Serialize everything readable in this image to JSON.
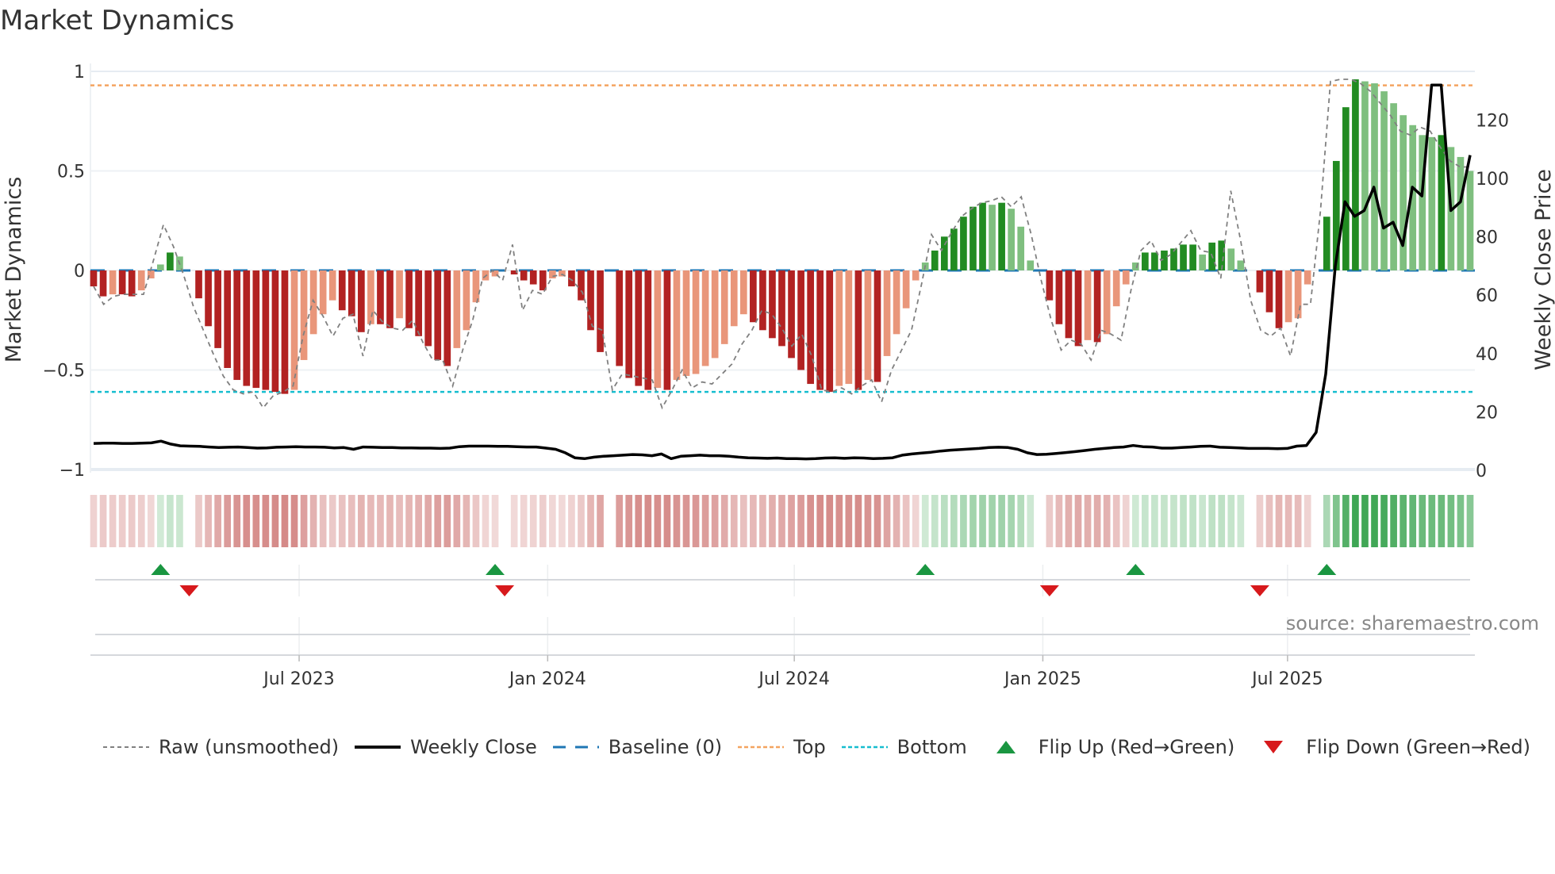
{
  "title": "Market Dynamics",
  "source": "source: sharemaestro.com",
  "legend": [
    {
      "key": "raw",
      "label": "Raw (unsmoothed)"
    },
    {
      "key": "close",
      "label": "Weekly Close"
    },
    {
      "key": "baseline",
      "label": "Baseline (0)"
    },
    {
      "key": "top",
      "label": "Top"
    },
    {
      "key": "bottom",
      "label": "Bottom"
    },
    {
      "key": "flip_up",
      "label": "Flip Up (Red→Green)"
    },
    {
      "key": "flip_down",
      "label": "Flip Down (Green→Red)"
    }
  ],
  "colors": {
    "dark_green": "#228b22",
    "light_green": "#7fbf7f",
    "dark_red": "#b22222",
    "light_red": "#e9967a",
    "baseline": "#1f77b4",
    "top": "#f4a460",
    "bottom": "#17becf",
    "raw": "#808080",
    "close": "#000000",
    "flip_up": "#1a9641",
    "flip_down": "#d7191c"
  },
  "chart_data": {
    "type": "bar",
    "title": "Market Dynamics",
    "ylabel": "Market Dynamics",
    "y2label": "Weekly Close Price",
    "ylim": [
      -1,
      1
    ],
    "y2lim": [
      0,
      136
    ],
    "yticks": [
      {
        "v": 1,
        "label": "1"
      },
      {
        "v": 0.5,
        "label": "0.5"
      },
      {
        "v": 0,
        "label": "0"
      },
      {
        "v": -0.5,
        "label": "−0.5"
      },
      {
        "v": -1,
        "label": "−1"
      }
    ],
    "y2ticks": [
      {
        "v": 0,
        "label": "0"
      },
      {
        "v": 20,
        "label": "20"
      },
      {
        "v": 40,
        "label": "40"
      },
      {
        "v": 60,
        "label": "60"
      },
      {
        "v": 80,
        "label": "80"
      },
      {
        "v": 100,
        "label": "100"
      },
      {
        "v": 120,
        "label": "120"
      }
    ],
    "xticks": [
      {
        "week": 21.5,
        "label": "Jul 2023"
      },
      {
        "week": 47.5,
        "label": "Jan 2024"
      },
      {
        "week": 73.3,
        "label": "Jul 2024"
      },
      {
        "week": 99.3,
        "label": "Jan 2025"
      },
      {
        "week": 124.9,
        "label": "Jul 2025"
      }
    ],
    "top": 0.93,
    "bottom": -0.61,
    "dynamics": [
      -0.08,
      -0.13,
      -0.12,
      -0.12,
      -0.13,
      -0.1,
      -0.04,
      0.03,
      0.09,
      0.07,
      0.0,
      -0.14,
      -0.28,
      -0.39,
      -0.49,
      -0.55,
      -0.58,
      -0.59,
      -0.6,
      -0.61,
      -0.62,
      -0.6,
      -0.45,
      -0.32,
      -0.22,
      -0.15,
      -0.2,
      -0.23,
      -0.31,
      -0.27,
      -0.27,
      -0.29,
      -0.24,
      -0.29,
      -0.33,
      -0.38,
      -0.45,
      -0.48,
      -0.39,
      -0.3,
      -0.16,
      -0.05,
      -0.03,
      0.0,
      -0.02,
      -0.05,
      -0.07,
      -0.1,
      -0.04,
      -0.03,
      -0.08,
      -0.15,
      -0.3,
      -0.41,
      0.0,
      -0.48,
      -0.54,
      -0.58,
      -0.6,
      -0.59,
      -0.6,
      -0.55,
      -0.53,
      -0.52,
      -0.48,
      -0.44,
      -0.37,
      -0.28,
      -0.22,
      -0.26,
      -0.3,
      -0.34,
      -0.38,
      -0.44,
      -0.5,
      -0.57,
      -0.6,
      -0.61,
      -0.58,
      -0.57,
      -0.6,
      -0.55,
      -0.56,
      -0.43,
      -0.32,
      -0.19,
      -0.05,
      0.04,
      0.1,
      0.17,
      0.21,
      0.27,
      0.32,
      0.34,
      0.33,
      0.34,
      0.31,
      0.22,
      0.05,
      0.0,
      -0.15,
      -0.27,
      -0.34,
      -0.38,
      -0.35,
      -0.36,
      -0.32,
      -0.18,
      -0.07,
      0.04,
      0.09,
      0.09,
      0.1,
      0.11,
      0.13,
      0.13,
      0.08,
      0.14,
      0.15,
      0.11,
      0.05,
      0.0,
      -0.11,
      -0.21,
      -0.29,
      -0.26,
      -0.24,
      -0.07,
      0.0,
      0.27,
      0.55,
      0.82,
      0.96,
      0.95,
      0.94,
      0.9,
      0.84,
      0.78,
      0.73,
      0.68,
      0.67,
      0.68,
      0.62,
      0.57,
      0.5
    ],
    "raw": [
      -0.08,
      -0.17,
      -0.13,
      -0.12,
      -0.12,
      -0.12,
      0.05,
      0.23,
      0.12,
      -0.02,
      -0.18,
      -0.3,
      -0.42,
      -0.53,
      -0.6,
      -0.62,
      -0.61,
      -0.69,
      -0.63,
      -0.61,
      -0.58,
      -0.33,
      -0.15,
      -0.23,
      -0.33,
      -0.24,
      -0.22,
      -0.43,
      -0.2,
      -0.26,
      -0.29,
      -0.3,
      -0.25,
      -0.36,
      -0.45,
      -0.45,
      -0.58,
      -0.4,
      -0.25,
      -0.04,
      0.0,
      -0.05,
      0.13,
      -0.2,
      -0.1,
      -0.12,
      -0.03,
      -0.02,
      -0.05,
      -0.11,
      -0.28,
      -0.3,
      -0.6,
      -0.52,
      -0.53,
      -0.54,
      -0.55,
      -0.69,
      -0.6,
      -0.5,
      -0.59,
      -0.56,
      -0.57,
      -0.52,
      -0.47,
      -0.37,
      -0.3,
      -0.2,
      -0.22,
      -0.29,
      -0.38,
      -0.32,
      -0.43,
      -0.6,
      -0.61,
      -0.59,
      -0.62,
      -0.58,
      -0.55,
      -0.66,
      -0.5,
      -0.4,
      -0.3,
      -0.07,
      0.18,
      0.1,
      0.19,
      0.27,
      0.31,
      0.34,
      0.35,
      0.37,
      0.32,
      0.37,
      0.18,
      -0.05,
      -0.25,
      -0.4,
      -0.35,
      -0.37,
      -0.45,
      -0.3,
      -0.32,
      -0.35,
      -0.1,
      0.1,
      0.15,
      0.05,
      0.08,
      0.14,
      0.2,
      0.1,
      0.09,
      -0.04,
      0.4,
      0.15,
      -0.15,
      -0.3,
      -0.33,
      -0.29,
      -0.43,
      -0.17,
      -0.17,
      0.3,
      0.95,
      0.96,
      0.96,
      0.94,
      0.9,
      0.84,
      0.78,
      0.7,
      0.68,
      0.72,
      0.7,
      0.62,
      0.55,
      0.52,
      0.52
    ],
    "weekly_close": [
      9.2,
      9.3,
      9.3,
      9.2,
      9.2,
      9.3,
      9.4,
      10.0,
      9.0,
      8.4,
      8.3,
      8.2,
      8.0,
      7.8,
      7.9,
      8.0,
      7.8,
      7.6,
      7.7,
      7.9,
      8.0,
      8.1,
      8.0,
      8.0,
      7.9,
      7.7,
      7.8,
      7.2,
      8.0,
      7.9,
      7.8,
      7.8,
      7.7,
      7.7,
      7.6,
      7.6,
      7.5,
      7.6,
      8.1,
      8.3,
      8.3,
      8.3,
      8.2,
      8.2,
      8.1,
      8.0,
      8.0,
      7.6,
      7.2,
      6.0,
      4.3,
      4.0,
      4.5,
      4.8,
      5.0,
      5.2,
      5.4,
      5.3,
      5.0,
      5.6,
      4.0,
      4.8,
      5.0,
      5.2,
      5.0,
      5.0,
      4.8,
      4.5,
      4.3,
      4.2,
      4.1,
      4.2,
      4.0,
      4.0,
      3.9,
      4.0,
      4.2,
      4.3,
      4.1,
      4.3,
      4.2,
      4.0,
      4.1,
      4.3,
      5.2,
      5.6,
      5.9,
      6.2,
      6.6,
      6.9,
      7.1,
      7.3,
      7.5,
      7.8,
      7.9,
      7.8,
      7.2,
      6.0,
      5.4,
      5.5,
      5.8,
      6.1,
      6.4,
      6.8,
      7.2,
      7.5,
      7.8,
      8.0,
      8.5,
      8.1,
      8.0,
      7.6,
      7.6,
      7.8,
      8.0,
      8.2,
      8.3,
      7.9,
      7.8,
      7.7,
      7.5,
      7.5,
      7.5,
      7.4,
      7.5,
      8.3,
      8.5,
      13,
      33,
      70,
      92,
      87,
      89,
      97,
      83,
      85,
      77,
      97,
      94,
      132,
      132,
      89,
      92,
      108
    ],
    "flip_up_weeks": [
      7,
      42,
      87,
      109,
      129
    ],
    "flip_down_weeks": [
      10,
      43,
      100,
      122
    ],
    "grid": true,
    "legend_position": "bottom"
  }
}
